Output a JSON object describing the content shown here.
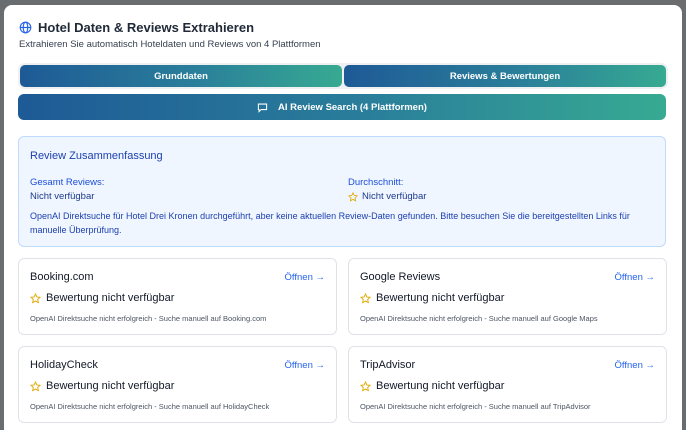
{
  "background": {
    "text": ""
  },
  "header": {
    "title": "Hotel Daten & Reviews Extrahieren",
    "subtitle": "Extrahieren Sie automatisch Hoteldaten und Reviews von 4 Plattformen",
    "icon": "globe-icon"
  },
  "tabs": [
    {
      "label": "Grunddaten"
    },
    {
      "label": "Reviews & Bewertungen"
    }
  ],
  "ai_search": {
    "label": "AI Review Search (4 Plattformen)",
    "icon": "message-icon"
  },
  "summary": {
    "title": "Review Zusammenfassung",
    "total_label": "Gesamt Reviews:",
    "total_value": "Nicht verfügbar",
    "avg_label": "Durchschnitt:",
    "avg_value": "Nicht verfügbar",
    "description": "OpenAI Direktsuche für Hotel Drei Kronen durchgeführt, aber keine aktuellen Review-Daten gefunden. Bitte besuchen Sie die bereitgestellten Links für manuelle Überprüfung."
  },
  "platforms": [
    {
      "name": "Booking.com",
      "open": "Öffnen →",
      "rating": "Bewertung nicht verfügbar",
      "note": "OpenAI Direktsuche nicht erfolgreich - Suche manuell auf Booking.com"
    },
    {
      "name": "Google Reviews",
      "open": "Öffnen →",
      "rating": "Bewertung nicht verfügbar",
      "note": "OpenAI Direktsuche nicht erfolgreich - Suche manuell auf Google Maps"
    },
    {
      "name": "HolidayCheck",
      "open": "Öffnen →",
      "rating": "Bewertung nicht verfügbar",
      "note": "OpenAI Direktsuche nicht erfolgreich - Suche manuell auf HolidayCheck"
    },
    {
      "name": "TripAdvisor",
      "open": "Öffnen →",
      "rating": "Bewertung nicht verfügbar",
      "note": "OpenAI Direktsuche nicht erfolgreich - Suche manuell auf TripAdvisor"
    }
  ],
  "colors": {
    "accent_start": "#1e5a96",
    "accent_end": "#37aa92",
    "star": "#e0a800",
    "link": "#2563eb"
  }
}
